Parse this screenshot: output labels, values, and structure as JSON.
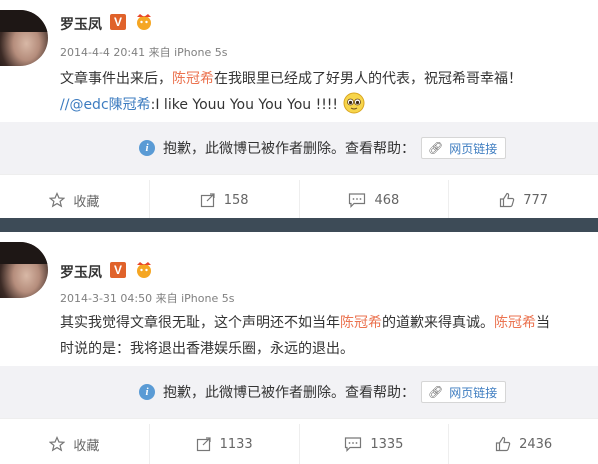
{
  "posts": [
    {
      "author": "罗玉凤",
      "verified_mark": "V",
      "meta": "2014-4-4 20:41 来自 iPhone 5s",
      "line1_a": "文章事件出来后，",
      "line1_mention": "陈冠希",
      "line1_b": "在我眼里已经成了好男人的代表，祝冠希哥幸福！",
      "line2_prefix": "//",
      "line2_user": "@edc陳冠希",
      "line2_text": ":I like Youu You You You !!!!",
      "deleted_notice": "抱歉，此微博已被作者删除。查看帮助：",
      "link_button": "网页链接",
      "actions": {
        "favorite": "收藏",
        "repost": "158",
        "comment": "468",
        "like": "777"
      }
    },
    {
      "author": "罗玉凤",
      "verified_mark": "V",
      "meta": "2014-3-31 04:50 来自 iPhone 5s",
      "line1_a": "其实我觉得文章很无耻，这个声明还不如当年",
      "line1_mention": "陈冠希",
      "line1_b": "的道歉来得真诚。",
      "line1_mention2": "陈冠希",
      "line1_c": "当",
      "line2_text": "时说的是：我将退出香港娱乐圈，永远的退出。",
      "deleted_notice": "抱歉，此微博已被作者删除。查看帮助：",
      "link_button": "网页链接",
      "actions": {
        "favorite": "收藏",
        "repost": "1133",
        "comment": "1335",
        "like": "2436"
      }
    }
  ],
  "colors": {
    "mention": "#eb7350",
    "link": "#3d7cc0",
    "divider": "#3d4b57",
    "notice_bg": "#f2f2f5"
  }
}
